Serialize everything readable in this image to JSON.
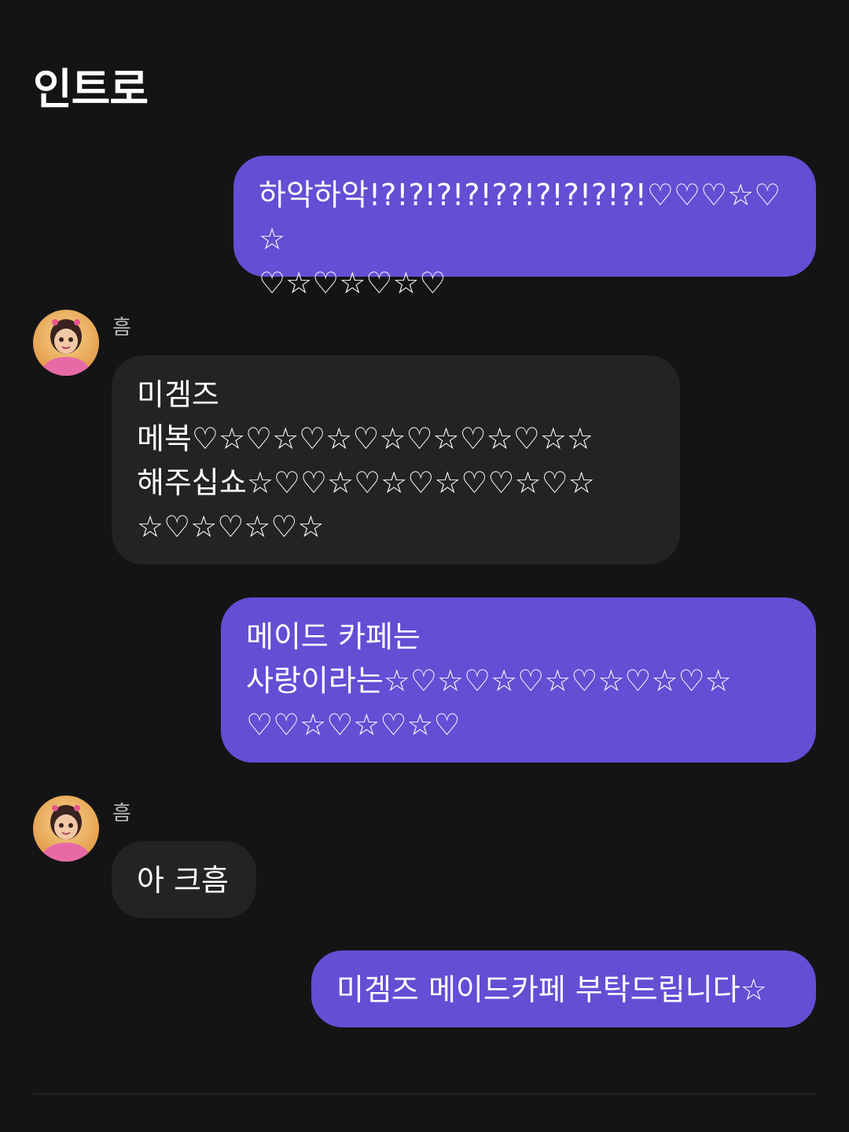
{
  "page": {
    "title": "인트로"
  },
  "messages": [
    {
      "side": "me",
      "text": "하악하악!?!?!?!?!??!?!?!?!?!♡♡♡☆♡☆\n♡☆♡☆♡☆♡"
    },
    {
      "side": "other",
      "sender": "흠",
      "text": "미겜즈\n메복♡☆♡☆♡☆♡☆♡☆♡☆♡☆☆\n해주십쇼☆♡♡☆♡☆♡☆♡♡☆♡☆\n☆♡☆♡☆♡☆"
    },
    {
      "side": "me",
      "text": "메이드 카페는\n사랑이라는☆♡☆♡☆♡☆♡☆♡☆♡☆\n♡♡☆♡☆♡☆♡"
    },
    {
      "side": "other",
      "sender": "흠",
      "text": "아 크흠"
    },
    {
      "side": "me",
      "text": "미겜즈 메이드카페 부탁드립니다☆"
    }
  ],
  "colors": {
    "background": "#141415",
    "my_bubble": "#624fd4",
    "other_bubble": "#232325",
    "sender_text": "#b9b9bd"
  },
  "icons": {
    "avatar": "girl-avatar-icon"
  }
}
